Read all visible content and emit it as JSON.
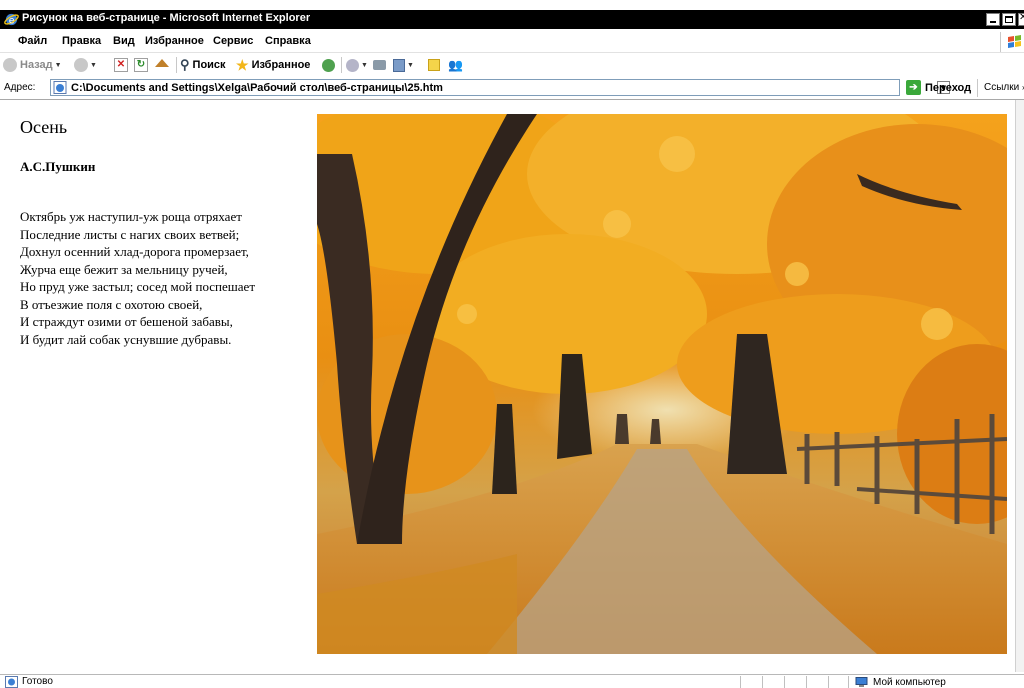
{
  "window": {
    "title": "Рисунок на веб-странице - Microsoft Internet Explorer"
  },
  "menu": {
    "items": [
      "Файл",
      "Правка",
      "Вид",
      "Избранное",
      "Сервис",
      "Справка"
    ]
  },
  "toolbar": {
    "back_label": "Назад",
    "search_label": "Поиск",
    "favorites_label": "Избранное"
  },
  "address": {
    "label": "Адрес:",
    "url": "C:\\Documents and Settings\\Xelga\\Рабочий стол\\веб-страницы\\25.htm",
    "go_label": "Переход",
    "links_label": "Ссылки"
  },
  "page": {
    "heading": "Осень",
    "author": "А.С.Пушкин",
    "poem_lines": [
      "Октябрь уж наступил-уж роща отряхает",
      "Последние листы с нагих своих ветвей;",
      "Дохнул осенний хлад-дорога промерзает,",
      "Журча еще бежит за мельницу ручей,",
      "Но пруд уже застыл; сосед мой поспешает",
      "В отъезжие поля с охотою своей,",
      "И страждут озими от бешеной забавы,",
      "И будит лай собак уснувшие дубравы."
    ]
  },
  "status": {
    "text": "Готово",
    "zone": "Мой компьютер"
  }
}
